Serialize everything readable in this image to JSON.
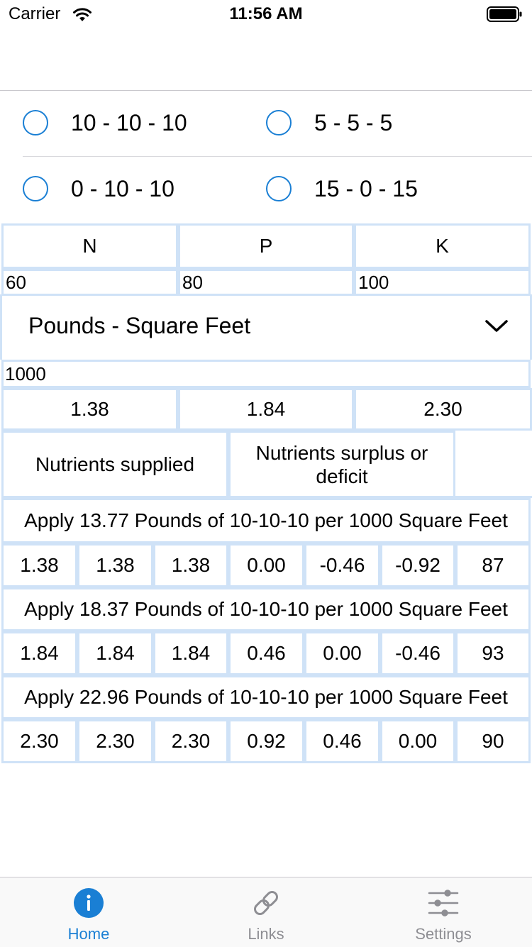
{
  "status_bar": {
    "carrier": "Carrier",
    "time": "11:56 AM"
  },
  "ratio_options": [
    {
      "label": "10 - 10 - 10"
    },
    {
      "label": "5 - 5 - 5"
    },
    {
      "label": "0 - 10 - 10"
    },
    {
      "label": "15 - 0 - 15"
    }
  ],
  "npk": {
    "headers": [
      "N",
      "P",
      "K"
    ],
    "inputs": [
      "60",
      "80",
      "100"
    ]
  },
  "unit_selector": {
    "value": "Pounds - Square Feet"
  },
  "area_input": "1000",
  "per_area_values": [
    "1.38",
    "1.84",
    "2.30"
  ],
  "result_headers": {
    "supplied": "Nutrients supplied",
    "surplus": "Nutrients surplus or deficit"
  },
  "results": [
    {
      "instruction": "Apply 13.77 Pounds of 10-10-10 per 1000 Square Feet",
      "values": [
        "1.38",
        "1.38",
        "1.38",
        "0.00",
        "-0.46",
        "-0.92",
        "87"
      ]
    },
    {
      "instruction": "Apply 18.37 Pounds of 10-10-10 per 1000 Square Feet",
      "values": [
        "1.84",
        "1.84",
        "1.84",
        "0.46",
        "0.00",
        "-0.46",
        "93"
      ]
    },
    {
      "instruction": "Apply 22.96 Pounds of 10-10-10 per 1000 Square Feet",
      "values": [
        "2.30",
        "2.30",
        "2.30",
        "0.92",
        "0.46",
        "0.00",
        "90"
      ]
    }
  ],
  "tab_bar": {
    "tabs": [
      {
        "label": "Home",
        "icon": "info-icon",
        "active": true
      },
      {
        "label": "Links",
        "icon": "link-icon",
        "active": false
      },
      {
        "label": "Settings",
        "icon": "sliders-icon",
        "active": false
      }
    ]
  },
  "colors": {
    "accent": "#1a7fd4",
    "grid_border": "#cfe2f7",
    "inactive": "#8e8e93"
  }
}
